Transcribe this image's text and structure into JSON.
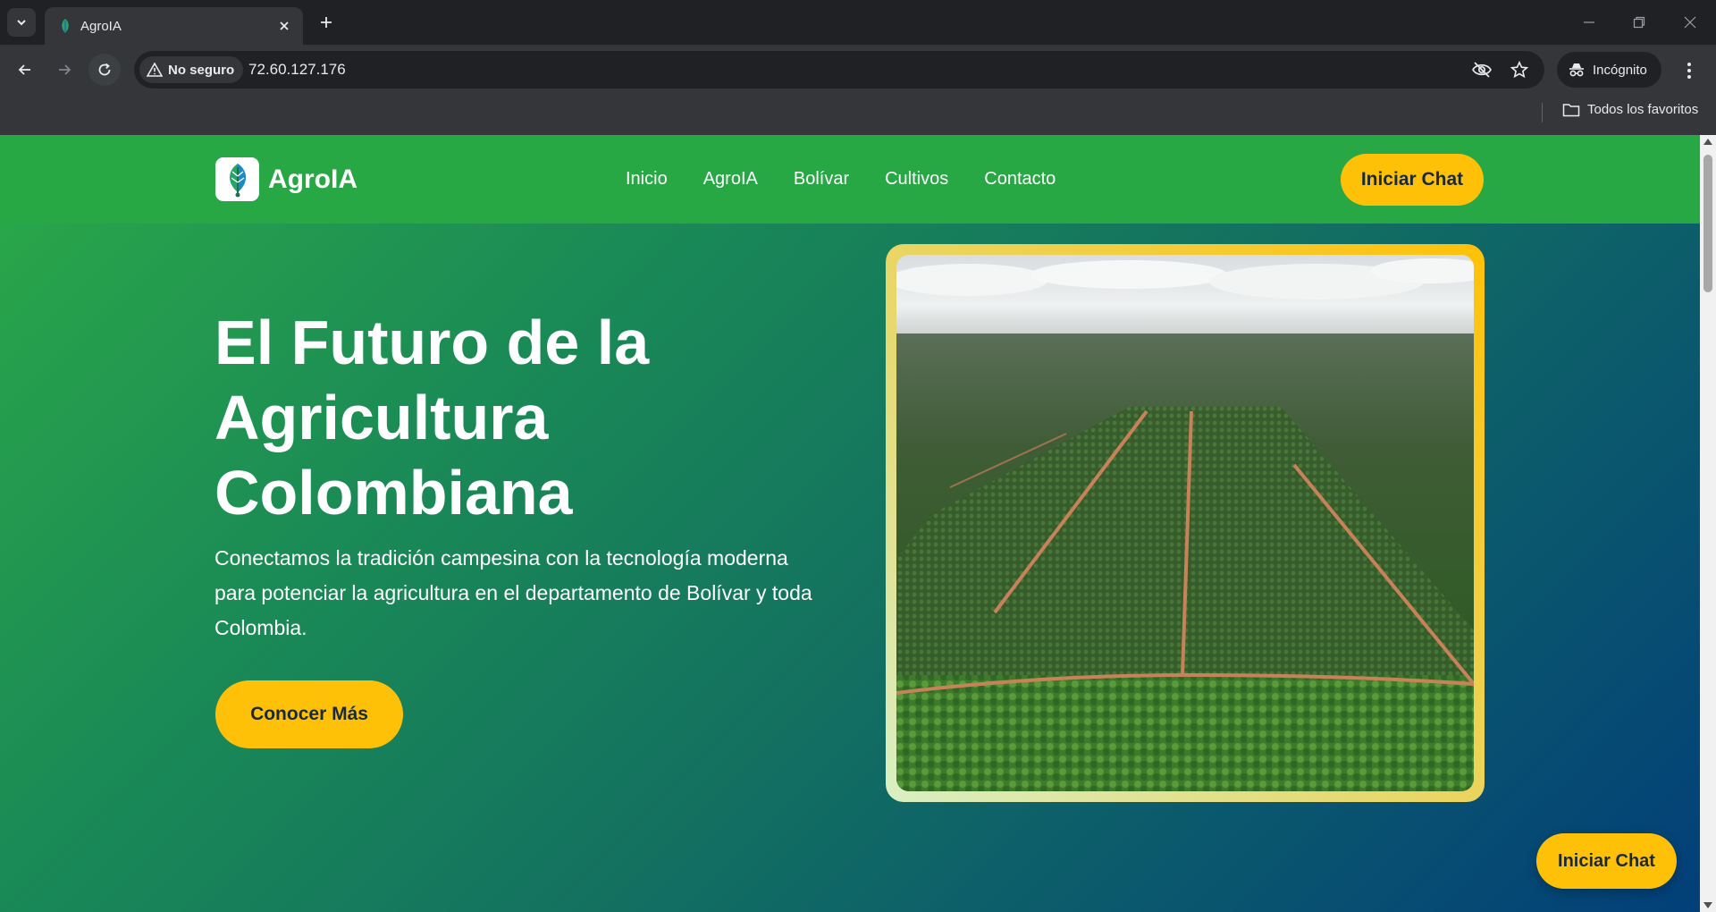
{
  "browser": {
    "tab_title": "AgroIA",
    "security_label": "No seguro",
    "url": "72.60.127.176",
    "incognito_label": "Incógnito",
    "bookmarks_folder": "Todos los favoritos"
  },
  "site": {
    "logo_text": "AgroIA",
    "nav": [
      "Inicio",
      "AgroIA",
      "Bolívar",
      "Cultivos",
      "Contacto"
    ],
    "header_cta": "Iniciar Chat",
    "hero": {
      "title": "El Futuro de la Agricultura Colombiana",
      "text": "Conectamos la tradición campesina con la tecnología moderna para potenciar la agricultura en el departamento de Bolívar y toda Colombia.",
      "cta": "Conocer Más"
    },
    "floating_cta": "Iniciar Chat"
  },
  "colors": {
    "header_green": "#28a745",
    "accent_yellow": "#ffc107",
    "gradient_end_blue": "#023f79"
  }
}
